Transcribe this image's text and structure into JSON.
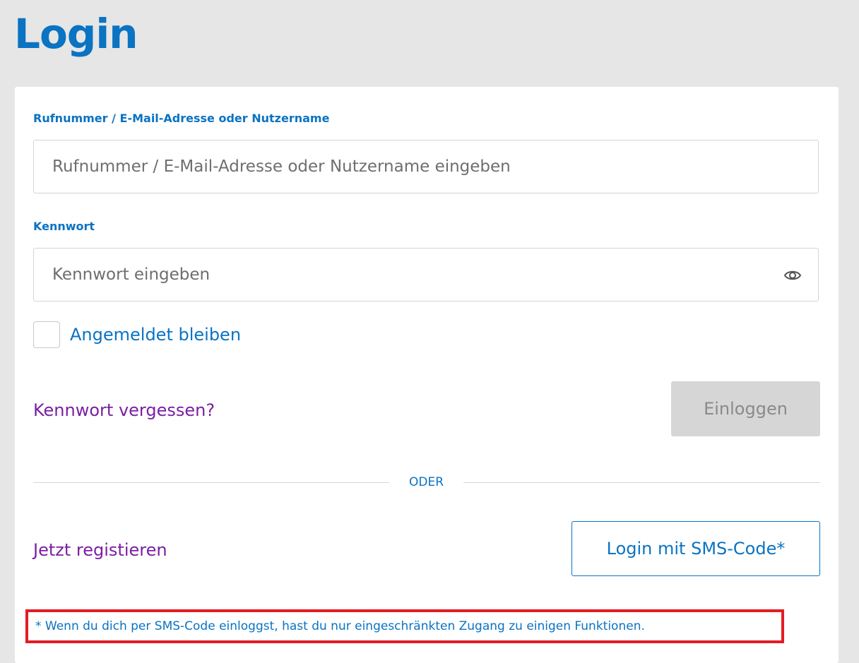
{
  "page": {
    "title": "Login"
  },
  "form": {
    "identifier_label": "Rufnummer / E-Mail-Adresse oder Nutzername",
    "identifier_placeholder": "Rufnummer / E-Mail-Adresse oder Nutzername eingeben",
    "password_label": "Kennwort",
    "password_placeholder": "Kennwort eingeben",
    "remember_label": "Angemeldet bleiben",
    "forgot_link": "Kennwort vergessen?",
    "login_button": "Einloggen",
    "divider": "ODER",
    "register_link": "Jetzt registieren",
    "sms_button": "Login mit SMS-Code*",
    "footnote": "* Wenn du dich per SMS-Code einloggst, hast du nur eingeschränkten Zugang zu einigen Funktionen."
  },
  "icons": {
    "password_toggle": "eye-icon"
  },
  "colors": {
    "primary_blue": "#0a73c2",
    "link_purple": "#7a1fa2",
    "disabled_button": "#d6d6d6",
    "highlight_red": "#e31c23",
    "background": "#e6e6e6"
  }
}
